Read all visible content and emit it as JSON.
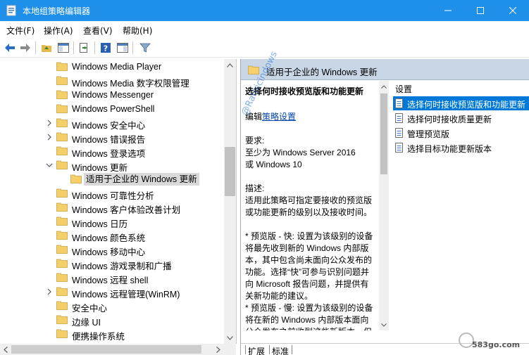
{
  "window": {
    "title": "本地组策略编辑器",
    "accent": "#1e90ea"
  },
  "menu": [
    "文件(F)",
    "操作(A)",
    "查看(V)",
    "帮助(H)"
  ],
  "tree": {
    "items": [
      {
        "label": "Windows Media Player",
        "expand": "none",
        "indent": 0
      },
      {
        "label": "Windows Media 数字权限管理",
        "expand": "none",
        "indent": 0
      },
      {
        "label": "Windows Messenger",
        "expand": "none",
        "indent": 0
      },
      {
        "label": "Windows PowerShell",
        "expand": "none",
        "indent": 0
      },
      {
        "label": "Windows 安全中心",
        "expand": "collapsed",
        "indent": 0
      },
      {
        "label": "Windows 错误报告",
        "expand": "collapsed",
        "indent": 0
      },
      {
        "label": "Windows 登录选项",
        "expand": "none",
        "indent": 0
      },
      {
        "label": "Windows 更新",
        "expand": "expanded",
        "indent": 0
      },
      {
        "label": "适用于企业的 Windows 更新",
        "expand": "none",
        "indent": 1,
        "selected": true
      },
      {
        "label": "Windows 可靠性分析",
        "expand": "none",
        "indent": 0
      },
      {
        "label": "Windows 客户体验改善计划",
        "expand": "none",
        "indent": 0
      },
      {
        "label": "Windows 日历",
        "expand": "none",
        "indent": 0
      },
      {
        "label": "Windows 颜色系统",
        "expand": "none",
        "indent": 0
      },
      {
        "label": "Windows 移动中心",
        "expand": "none",
        "indent": 0
      },
      {
        "label": "Windows 游戏录制和广播",
        "expand": "none",
        "indent": 0
      },
      {
        "label": "Windows 远程 shell",
        "expand": "none",
        "indent": 0
      },
      {
        "label": "Windows 远程管理(WinRM)",
        "expand": "collapsed",
        "indent": 0
      },
      {
        "label": "安全中心",
        "expand": "none",
        "indent": 0
      },
      {
        "label": "边缘 UI",
        "expand": "none",
        "indent": 0
      },
      {
        "label": "便携操作系统",
        "expand": "none",
        "indent": 0
      }
    ]
  },
  "right": {
    "header_title": "适用于企业的 Windows 更新",
    "description": {
      "title": "选择何时接收预览版和功能更新",
      "edit_prefix": "编辑",
      "edit_link": "策略设置",
      "req_label": "要求:",
      "req_line1": "至少为 Windows Server 2016",
      "req_line2": "或 Windows 10",
      "desc_label": "描述:",
      "desc_lines": [
        "适用此策略可指定要接收的预览版",
        "或功能更新的级别以及接收时间。",
        "",
        "* 预览版 - 快: 设置为该级别的设备",
        "将最先收到新的 Windows 内部版",
        "本，其中包含尚未面向公众发布的",
        "功能。选择“快”可参与识别问题并",
        "向 Microsoft 报告问题，并提供有",
        "关新功能的建议。",
        "* 预览版 - 慢: 设置为该级别的设备",
        "将在新的 Windows 内部版本面向",
        "公众发布之前收到这些新版本，但"
      ]
    },
    "settings": {
      "column_header": "设置",
      "items": [
        {
          "label": "选择何时接收预览版和功能更新",
          "selected": true
        },
        {
          "label": "选择何时接收质量更新",
          "selected": false
        },
        {
          "label": "管理预览版",
          "selected": false
        },
        {
          "label": "选择目标功能更新版本",
          "selected": false
        }
      ]
    },
    "tabs": [
      "扩展",
      "标准"
    ]
  },
  "watermark": "@Ratnicindows",
  "logo_text": "583go.com"
}
